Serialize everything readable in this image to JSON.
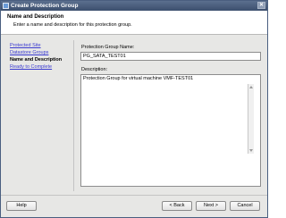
{
  "window": {
    "title": "Create Protection Group",
    "close_glyph": "✕"
  },
  "header": {
    "title": "Name and Description",
    "subtitle": "Enter a name and description for this protection group."
  },
  "nav": {
    "items": [
      {
        "label": "Protected Site",
        "state": "link"
      },
      {
        "label": "Datastore Groups",
        "state": "link"
      },
      {
        "label": "Name and Description",
        "state": "current"
      },
      {
        "label": "Ready to Complete",
        "state": "link"
      }
    ]
  },
  "form": {
    "name_label": "Protection Group Name:",
    "name_value": "PG_SATA_TEST01",
    "description_label": "Description:",
    "description_value": "Protection Group for virtual machine VMF-TEST01"
  },
  "buttons": {
    "help": "Help",
    "back": "< Back",
    "next": "Next >",
    "cancel": "Cancel"
  },
  "colors": {
    "titlebar": "#3c4f6e",
    "link": "#3a3ad0",
    "content_bg": "#e7e7e5"
  }
}
